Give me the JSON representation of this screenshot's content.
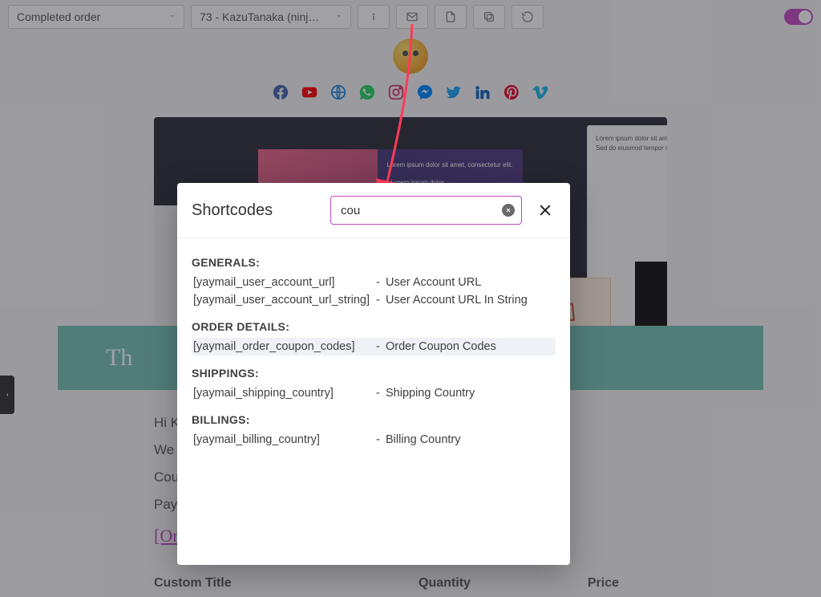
{
  "toolbar": {
    "template_select": "Completed order",
    "order_select": "73 - KazuTanaka (ninj…",
    "toggle_on": true
  },
  "email": {
    "banner_prefix": "Th",
    "lines": {
      "l1": "Hi K",
      "l2": "We ",
      "l3": "Cou",
      "l4": "Pay",
      "link": "[Or"
    },
    "side_card": "DAY",
    "table": {
      "c1": "Custom Title",
      "c2": "Quantity",
      "c3": "Price"
    }
  },
  "modal": {
    "title": "Shortcodes",
    "search_value": "cou",
    "groups": [
      {
        "heading": "GENERALS:",
        "rows": [
          {
            "code": "[yaymail_user_account_url]",
            "desc": "User Account URL"
          },
          {
            "code": "[yaymail_user_account_url_string]",
            "desc": "User Account URL In String"
          }
        ]
      },
      {
        "heading": "ORDER DETAILS:",
        "rows": [
          {
            "code": "[yaymail_order_coupon_codes]",
            "desc": "Order Coupon Codes",
            "hilite": true
          }
        ]
      },
      {
        "heading": "SHIPPINGS:",
        "rows": [
          {
            "code": "[yaymail_shipping_country]",
            "desc": "Shipping Country"
          }
        ]
      },
      {
        "heading": "BILLINGS:",
        "rows": [
          {
            "code": "[yaymail_billing_country]",
            "desc": "Billing Country"
          }
        ]
      }
    ]
  },
  "social": [
    {
      "name": "facebook",
      "fill": "#4267B2"
    },
    {
      "name": "youtube",
      "fill": "#FF0000"
    },
    {
      "name": "globe",
      "fill": "#1e88e5"
    },
    {
      "name": "whatsapp",
      "fill": "#25D366"
    },
    {
      "name": "instagram",
      "fill": "#E1306C"
    },
    {
      "name": "messenger",
      "fill": "#0084FF"
    },
    {
      "name": "twitter",
      "fill": "#1DA1F2"
    },
    {
      "name": "linkedin",
      "fill": "#0A66C2"
    },
    {
      "name": "pinterest",
      "fill": "#E60023"
    },
    {
      "name": "vimeo",
      "fill": "#1AB7EA"
    }
  ]
}
